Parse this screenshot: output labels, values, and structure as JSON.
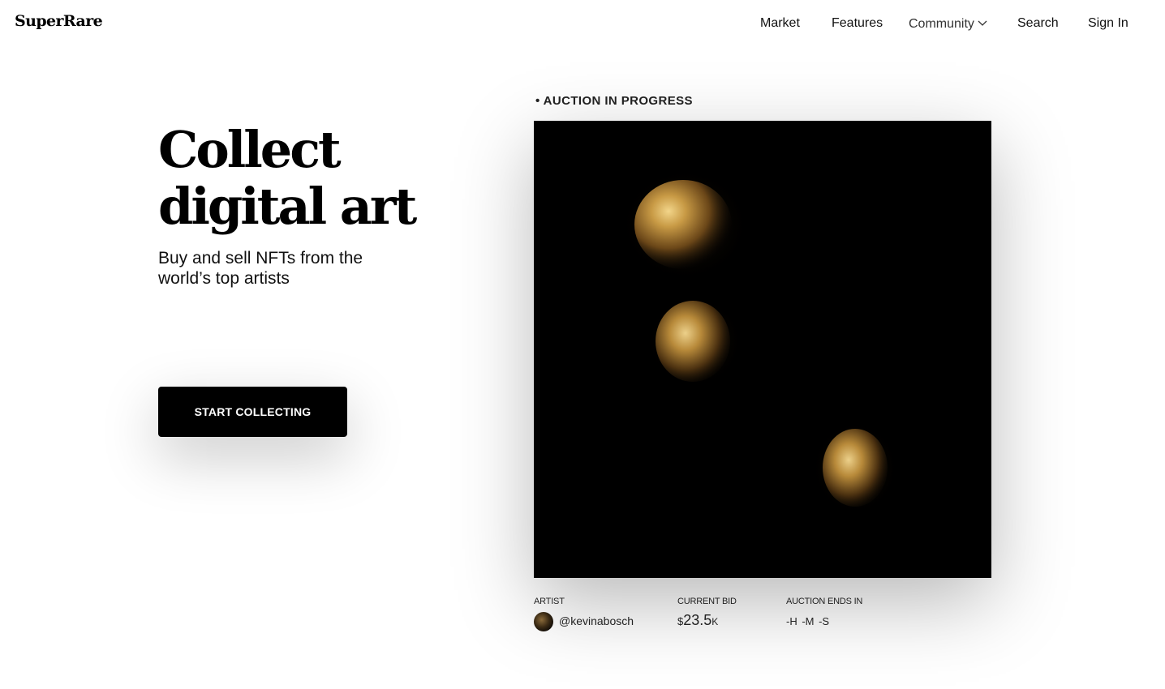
{
  "header": {
    "logo": "SuperRare",
    "nav": {
      "market": "Market",
      "features": "Features",
      "community": "Community",
      "search": "Search",
      "sign_in": "Sign In"
    }
  },
  "hero": {
    "title_line1": "Collect",
    "title_line2": "digital art",
    "subtitle": "Buy and sell NFTs from the world’s top artists",
    "cta": "START COLLECTING"
  },
  "auction": {
    "status": "• AUCTION IN PROGRESS",
    "artist_label": "ARTIST",
    "artist_handle": "@kevinabosch",
    "bid_label": "CURRENT BID",
    "bid_currency": "$",
    "bid_amount": "23.5",
    "bid_unit": "K",
    "ends_label": "AUCTION ENDS IN",
    "countdown": "-H -M -S"
  },
  "colors": {
    "background": "#ffffff",
    "text": "#000000",
    "button_bg": "#000000",
    "button_text": "#ffffff",
    "artwork_bg": "#000000",
    "gold": "#c8a050"
  },
  "icons": {
    "community_dropdown": "chevron-down-icon"
  }
}
